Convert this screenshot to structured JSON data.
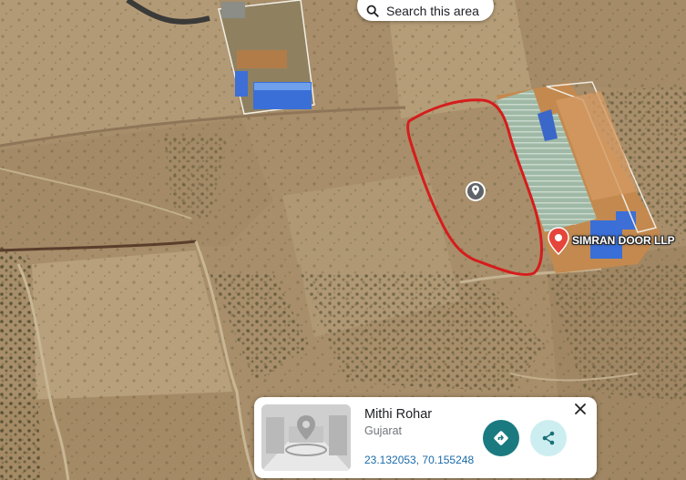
{
  "search": {
    "label": "Search this area",
    "icon": "search-icon"
  },
  "map": {
    "type": "satellite",
    "colors": {
      "terrain": "#a88e6a",
      "boundary_outline": "#d61c1c",
      "roof_blue": "#3a6fd8"
    }
  },
  "poi": {
    "label": "SIMRAN DOOR LLP",
    "icon": "place-marker-icon",
    "color": "#e5453a"
  },
  "dropped_pin": {
    "icon": "dropped-pin-icon"
  },
  "place_card": {
    "title": "Mithi Rohar",
    "subtitle": "Gujarat",
    "coordinates": "23.132053, 70.155248",
    "close_icon": "close-icon",
    "directions_icon": "directions-icon",
    "share_icon": "share-icon",
    "thumbnail": "street-view-thumbnail"
  }
}
